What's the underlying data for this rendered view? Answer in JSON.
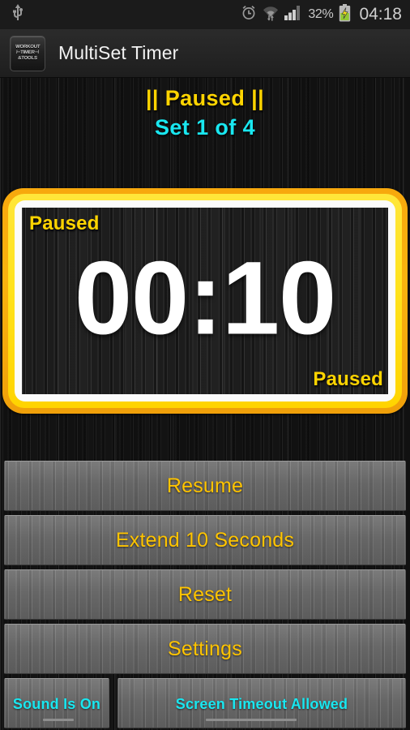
{
  "status_bar": {
    "usb_icon": "usb-icon",
    "alarm_icon": "alarm-clock-icon",
    "wifi_icon": "wifi-icon",
    "signal_icon": "cellular-signal-icon",
    "battery_percent": "32%",
    "battery_icon": "battery-charging-icon",
    "clock": "04:18"
  },
  "action_bar": {
    "app_icon_lines": [
      "WORKOUT",
      "⊢TIMER⊣",
      "&TOOLS"
    ],
    "title": "MultiSet Timer"
  },
  "header": {
    "status": "|| Paused ||",
    "set_progress": "Set 1 of 4"
  },
  "timer": {
    "label_top_left": "Paused",
    "value": "00:10",
    "label_bottom_right": "Paused"
  },
  "buttons": {
    "resume": "Resume",
    "extend": "Extend 10 Seconds",
    "reset": "Reset",
    "settings": "Settings",
    "sound_toggle": "Sound Is On",
    "screen_timeout_toggle": "Screen Timeout Allowed"
  },
  "colors": {
    "accent_yellow": "#ffd400",
    "button_text": "#ffc400",
    "accent_cyan": "#19e7f0",
    "frame_outer": "#f7a80d",
    "frame_inner": "#ffe21c",
    "timer_digits": "#ffffff",
    "background": "#151515"
  }
}
